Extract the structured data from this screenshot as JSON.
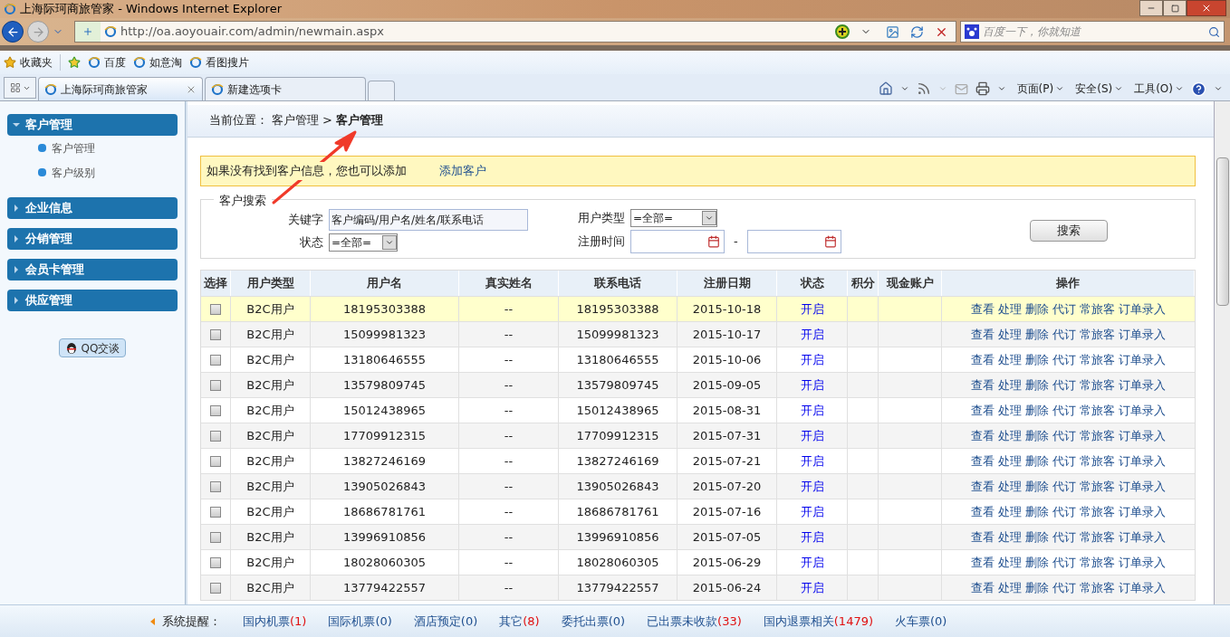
{
  "window": {
    "title": "上海际珂商旅管家 - Windows Internet Explorer"
  },
  "address_bar": {
    "url": "http://oa.aoyouair.com/admin/newmain.aspx",
    "search_placeholder": "百度一下，你就知道"
  },
  "favorites_bar": {
    "label": "收藏夹",
    "links": [
      "百度",
      "如意淘",
      "看图搜片"
    ]
  },
  "tabs": [
    {
      "label": "上海际珂商旅管家",
      "selected": true
    },
    {
      "label": "新建选项卡",
      "selected": false
    }
  ],
  "command_bar": [
    "页面(P)",
    "安全(S)",
    "工具(O)"
  ],
  "sidebar": {
    "sections": [
      {
        "label": "客户管理",
        "expanded": true,
        "children": [
          {
            "label": "客户管理"
          },
          {
            "label": "客户级别"
          }
        ]
      },
      {
        "label": "企业信息",
        "expanded": false
      },
      {
        "label": "分销管理",
        "expanded": false
      },
      {
        "label": "会员卡管理",
        "expanded": false
      },
      {
        "label": "供应管理",
        "expanded": false
      }
    ],
    "qq_button": "QQ交谈"
  },
  "breadcrumb": {
    "prefix": "当前位置：",
    "path": "客户管理",
    "separator": ">",
    "current": "客户管理"
  },
  "notice": {
    "text": "如果没有找到客户信息，您也可以添加",
    "link": "添加客户"
  },
  "search": {
    "title": "客户搜索",
    "keyword_label": "关键字",
    "keyword_value": "客户编码/用户名/姓名/联系电话",
    "status_label": "状态",
    "status_value": "=全部=",
    "user_type_label": "用户类型",
    "user_type_value": "=全部=",
    "date_label": "注册时间",
    "date_separator": "-",
    "button": "搜索"
  },
  "table": {
    "columns": [
      "选择",
      "用户类型",
      "用户名",
      "真实姓名",
      "联系电话",
      "注册日期",
      "状态",
      "积分",
      "现金账户",
      "操作"
    ],
    "rows": [
      {
        "selected": true,
        "checked": false,
        "user_type": "B2C用户",
        "username": "18195303388",
        "real_name": "--",
        "phone": "18195303388",
        "date": "2015-10-18",
        "status": "开启",
        "actions": [
          "查看",
          "处理",
          "删除",
          "代订",
          "常旅客",
          "订单录入"
        ]
      },
      {
        "selected": false,
        "checked": false,
        "user_type": "B2C用户",
        "username": "15099981323",
        "real_name": "--",
        "phone": "15099981323",
        "date": "2015-10-17",
        "status": "开启",
        "actions": [
          "查看",
          "处理",
          "删除",
          "代订",
          "常旅客",
          "订单录入"
        ]
      },
      {
        "selected": false,
        "checked": false,
        "user_type": "B2C用户",
        "username": "13180646555",
        "real_name": "--",
        "phone": "13180646555",
        "date": "2015-10-06",
        "status": "开启",
        "actions": [
          "查看",
          "处理",
          "删除",
          "代订",
          "常旅客",
          "订单录入"
        ]
      },
      {
        "selected": false,
        "checked": false,
        "user_type": "B2C用户",
        "username": "13579809745",
        "real_name": "--",
        "phone": "13579809745",
        "date": "2015-09-05",
        "status": "开启",
        "actions": [
          "查看",
          "处理",
          "删除",
          "代订",
          "常旅客",
          "订单录入"
        ]
      },
      {
        "selected": false,
        "checked": false,
        "user_type": "B2C用户",
        "username": "15012438965",
        "real_name": "--",
        "phone": "15012438965",
        "date": "2015-08-31",
        "status": "开启",
        "actions": [
          "查看",
          "处理",
          "删除",
          "代订",
          "常旅客",
          "订单录入"
        ]
      },
      {
        "selected": false,
        "checked": false,
        "user_type": "B2C用户",
        "username": "17709912315",
        "real_name": "--",
        "phone": "17709912315",
        "date": "2015-07-31",
        "status": "开启",
        "actions": [
          "查看",
          "处理",
          "删除",
          "代订",
          "常旅客",
          "订单录入"
        ]
      },
      {
        "selected": false,
        "checked": false,
        "user_type": "B2C用户",
        "username": "13827246169",
        "real_name": "--",
        "phone": "13827246169",
        "date": "2015-07-21",
        "status": "开启",
        "actions": [
          "查看",
          "处理",
          "删除",
          "代订",
          "常旅客",
          "订单录入"
        ]
      },
      {
        "selected": false,
        "checked": false,
        "user_type": "B2C用户",
        "username": "13905026843",
        "real_name": "--",
        "phone": "13905026843",
        "date": "2015-07-20",
        "status": "开启",
        "actions": [
          "查看",
          "处理",
          "删除",
          "代订",
          "常旅客",
          "订单录入"
        ]
      },
      {
        "selected": false,
        "checked": false,
        "user_type": "B2C用户",
        "username": "18686781761",
        "real_name": "--",
        "phone": "18686781761",
        "date": "2015-07-16",
        "status": "开启",
        "actions": [
          "查看",
          "处理",
          "删除",
          "代订",
          "常旅客",
          "订单录入"
        ]
      },
      {
        "selected": false,
        "checked": false,
        "user_type": "B2C用户",
        "username": "13996910856",
        "real_name": "--",
        "phone": "13996910856",
        "date": "2015-07-05",
        "status": "开启",
        "actions": [
          "查看",
          "处理",
          "删除",
          "代订",
          "常旅客",
          "订单录入"
        ]
      },
      {
        "selected": false,
        "checked": false,
        "user_type": "B2C用户",
        "username": "18028060305",
        "real_name": "--",
        "phone": "18028060305",
        "date": "2015-06-29",
        "status": "开启",
        "actions": [
          "查看",
          "处理",
          "删除",
          "代订",
          "常旅客",
          "订单录入"
        ]
      },
      {
        "selected": false,
        "checked": false,
        "user_type": "B2C用户",
        "username": "13779422557",
        "real_name": "--",
        "phone": "13779422557",
        "date": "2015-06-24",
        "status": "开启",
        "actions": [
          "查看",
          "处理",
          "删除",
          "代订",
          "常旅客",
          "订单录入"
        ]
      }
    ]
  },
  "status_bar": {
    "label": "系统提醒：",
    "items": [
      {
        "label": "国内机票",
        "count": "(1)",
        "alert": true
      },
      {
        "label": "国际机票",
        "count": "(0)",
        "alert": false
      },
      {
        "label": "酒店预定",
        "count": "(0)",
        "alert": false
      },
      {
        "label": "其它",
        "count": "(8)",
        "alert": true
      },
      {
        "label": "委托出票",
        "count": "(0)",
        "alert": false
      },
      {
        "label": "已出票未收款",
        "count": "(33)",
        "alert": true
      },
      {
        "label": "国内退票相关",
        "count": "(1479)",
        "alert": true
      },
      {
        "label": "火车票",
        "count": "(0)",
        "alert": false
      }
    ]
  }
}
